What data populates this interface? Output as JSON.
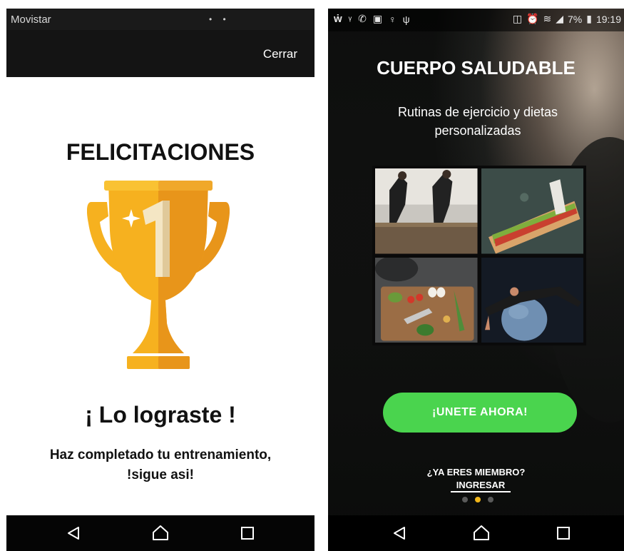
{
  "left": {
    "status": {
      "carrier": "Movistar",
      "dots": "• •"
    },
    "toolbar": {
      "close_label": "Cerrar"
    },
    "title": "FELICITACIONES",
    "trophy": {
      "number": "1",
      "icon": "trophy-icon"
    },
    "success_title": "¡ Lo lograste !",
    "success_message": "Haz completado tu entrenamiento, !sigue asi!"
  },
  "right": {
    "status": {
      "left_icons": [
        "w-icon",
        "signal-icon",
        "whatsapp-icon",
        "gallery-icon",
        "bulb-icon",
        "usb-icon"
      ],
      "battery": "7%",
      "time": "19:19"
    },
    "title": "CUERPO SALUDABLE",
    "subtitle": "Rutinas de ejercicio y dietas personalizadas",
    "photos": [
      {
        "name": "box-jump-photo"
      },
      {
        "name": "sandwich-photo"
      },
      {
        "name": "vegetables-photo"
      },
      {
        "name": "stability-ball-photo"
      }
    ],
    "join_label": "¡UNETE AHORA!",
    "member_prompt": "¿YA ERES MIEMBRO?",
    "login_label": "INGRESAR",
    "pager": {
      "count": 3,
      "active": 1
    }
  },
  "nav": {
    "back": "back-icon",
    "home": "home-icon",
    "recents": "recents-icon"
  },
  "colors": {
    "join_green": "#4ad44e",
    "pager_active": "#f2b61a",
    "trophy_gold": "#f6b11f",
    "trophy_dark": "#e8951a"
  }
}
